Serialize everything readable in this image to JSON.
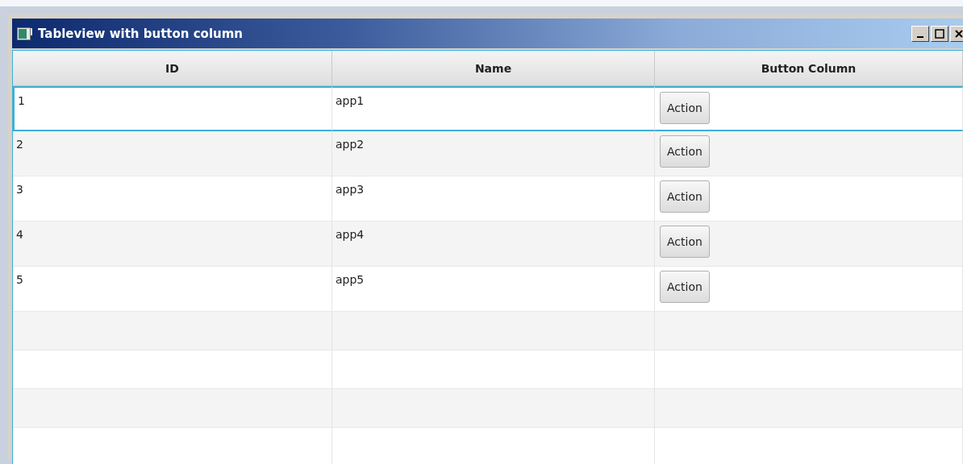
{
  "window": {
    "title": "Tableview with button column"
  },
  "table": {
    "columns": [
      "ID",
      "Name",
      "Button Column"
    ],
    "rows": [
      {
        "id": "1",
        "name": "app1",
        "button": "Action",
        "focused": true
      },
      {
        "id": "2",
        "name": "app2",
        "button": "Action",
        "focused": false
      },
      {
        "id": "3",
        "name": "app3",
        "button": "Action",
        "focused": false
      },
      {
        "id": "4",
        "name": "app4",
        "button": "Action",
        "focused": false
      },
      {
        "id": "5",
        "name": "app5",
        "button": "Action",
        "focused": false
      }
    ]
  }
}
